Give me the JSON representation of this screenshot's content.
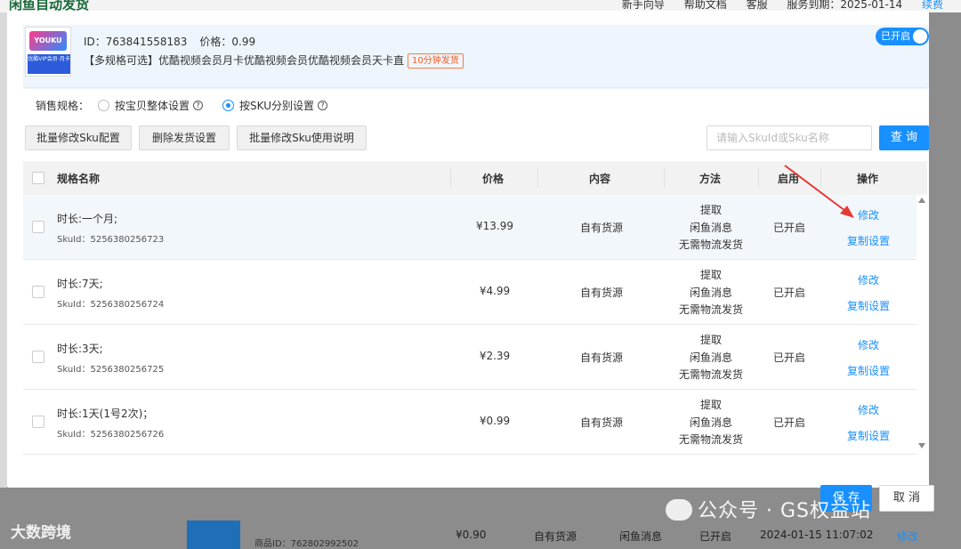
{
  "background": {
    "app_title": "闲鱼自动发货",
    "nav": [
      "新手向导",
      "帮助文档",
      "客服",
      "服务到期：2025-01-14"
    ],
    "renew_label": "续费",
    "row": {
      "product_id": "商品ID：762802992502",
      "price": "¥0.90",
      "content": "自有货源",
      "method": "闲鱼消息",
      "status": "已开启",
      "time": "2024-01-15 11:07:02",
      "edit": "修改"
    }
  },
  "product": {
    "id_label": "ID：763841558183",
    "price_label": "价格：0.99",
    "title": "【多规格可选】优酷视频会员月卡优酷视频会员优酷视频会员天卡直",
    "badge": "10分钟发货",
    "toggle_label": "已开启",
    "thumb_logo": "YOUKU",
    "thumb_text": "优酷VIP会员·月卡"
  },
  "spec": {
    "label": "销售规格：",
    "option_whole": "按宝贝整体设置",
    "option_sku": "按SKU分别设置",
    "selected": "sku"
  },
  "toolbar": {
    "batch_edit": "批量修改Sku配置",
    "delete_delivery": "删除发货设置",
    "batch_help": "批量修改Sku使用说明",
    "search_placeholder": "请输入SkuId或Sku名称",
    "query": "查 询"
  },
  "table": {
    "headers": {
      "name": "规格名称",
      "price": "价格",
      "content": "内容",
      "method": "方法",
      "enabled": "启用",
      "actions": "操作"
    },
    "rows": [
      {
        "name": "时长:一个月;",
        "sku": "SkuId：5256380256723",
        "price": "¥13.99",
        "content": "自有货源",
        "method": [
          "提取",
          "闲鱼消息",
          "无需物流发货"
        ],
        "enabled": "已开启",
        "edit": "修改",
        "copy": "复制设置"
      },
      {
        "name": "时长:7天;",
        "sku": "SkuId：5256380256724",
        "price": "¥4.99",
        "content": "自有货源",
        "method": [
          "提取",
          "闲鱼消息",
          "无需物流发货"
        ],
        "enabled": "已开启",
        "edit": "修改",
        "copy": "复制设置"
      },
      {
        "name": "时长:3天;",
        "sku": "SkuId：5256380256725",
        "price": "¥2.39",
        "content": "自有货源",
        "method": [
          "提取",
          "闲鱼消息",
          "无需物流发货"
        ],
        "enabled": "已开启",
        "edit": "修改",
        "copy": "复制设置"
      },
      {
        "name": "时长:1天(1号2次)；",
        "sku": "SkuId：5256380256726",
        "price": "¥0.99",
        "content": "自有货源",
        "method": [
          "提取",
          "闲鱼消息",
          "无需物流发货"
        ],
        "enabled": "已开启",
        "edit": "修改",
        "copy": "复制设置"
      }
    ]
  },
  "footer": {
    "save": "保 存",
    "cancel": "取 消"
  },
  "watermark": {
    "text": "公众号 · GS权益站",
    "corner": "大数跨境"
  },
  "colors": {
    "accent": "#1890ff",
    "badge": "#ff5a1f",
    "arrow": "#e53935"
  }
}
